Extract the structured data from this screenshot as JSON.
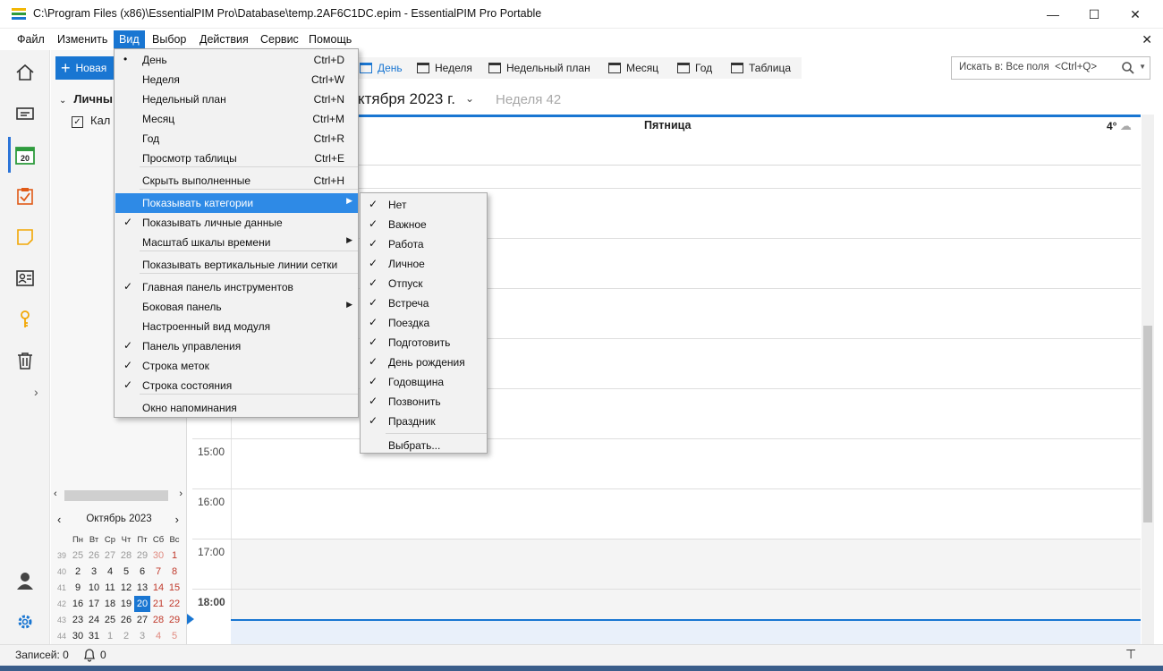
{
  "window": {
    "title": "C:\\Program Files (x86)\\EssentialPIM Pro\\Database\\temp.2AF6C1DC.epim - EssentialPIM Pro Portable",
    "minimize": "—",
    "maximize": "☐",
    "close": "✕"
  },
  "menubar": {
    "items": [
      "Файл",
      "Изменить",
      "Вид",
      "Выбор",
      "Действия",
      "Сервис",
      "Помощь"
    ],
    "active": "Вид",
    "close": "✕"
  },
  "sidebar": {
    "new_button": "Новая",
    "group": "Личны",
    "calendar_item": "Кал",
    "rail_icons": [
      "home-icon",
      "inbox-icon",
      "calendar-icon",
      "tasks-icon",
      "notes-icon",
      "contacts-icon",
      "passwords-icon",
      "trash-icon"
    ],
    "calendar_day": "20",
    "expand": "›"
  },
  "toolbar": {
    "views": [
      {
        "label": "День",
        "selected": true
      },
      {
        "label": "Неделя",
        "selected": false
      },
      {
        "label": "Недельный план",
        "selected": false
      },
      {
        "label": "Месяц",
        "selected": false
      },
      {
        "label": "Год",
        "selected": false
      },
      {
        "label": "Таблица",
        "selected": false
      }
    ],
    "search_placeholder": "Искать в: Все поля  <Ctrl+Q>"
  },
  "header": {
    "date_title": "ктября 2023 г.",
    "week": "Неделя 42",
    "day_name": "Пятница",
    "temperature": "4°"
  },
  "day_view": {
    "hours": [
      "15:00",
      "16:00",
      "17:00",
      "18:00"
    ],
    "grey_hours_from": "17:00"
  },
  "mini_calendar": {
    "title": "Октябрь  2023",
    "prev": "‹",
    "next": "›",
    "weekdays": [
      "Пн",
      "Вт",
      "Ср",
      "Чт",
      "Пт",
      "Сб",
      "Вс"
    ],
    "weeks": [
      {
        "no": "39",
        "days": [
          "25",
          "26",
          "27",
          "28",
          "29",
          "30",
          "1"
        ]
      },
      {
        "no": "40",
        "days": [
          "2",
          "3",
          "4",
          "5",
          "6",
          "7",
          "8"
        ]
      },
      {
        "no": "41",
        "days": [
          "9",
          "10",
          "11",
          "12",
          "13",
          "14",
          "15"
        ]
      },
      {
        "no": "42",
        "days": [
          "16",
          "17",
          "18",
          "19",
          "20",
          "21",
          "22"
        ]
      },
      {
        "no": "43",
        "days": [
          "23",
          "24",
          "25",
          "26",
          "27",
          "28",
          "29"
        ]
      },
      {
        "no": "44",
        "days": [
          "30",
          "31",
          "1",
          "2",
          "3",
          "4",
          "5"
        ]
      }
    ],
    "today": "20"
  },
  "view_menu": {
    "items": [
      {
        "label": "День",
        "shortcut": "Ctrl+D",
        "mark": "•"
      },
      {
        "label": "Неделя",
        "shortcut": "Ctrl+W",
        "mark": ""
      },
      {
        "label": "Недельный план",
        "shortcut": "Ctrl+N",
        "mark": ""
      },
      {
        "label": "Месяц",
        "shortcut": "Ctrl+M",
        "mark": ""
      },
      {
        "label": "Год",
        "shortcut": "Ctrl+R",
        "mark": ""
      },
      {
        "label": "Просмотр таблицы",
        "shortcut": "Ctrl+E",
        "mark": ""
      },
      {
        "label": "Скрыть выполненные",
        "shortcut": "Ctrl+H",
        "mark": ""
      },
      {
        "label": "Показывать категории",
        "shortcut": "",
        "mark": "",
        "submenu": true
      },
      {
        "label": "Показывать личные данные",
        "shortcut": "",
        "mark": "✓"
      },
      {
        "label": "Масштаб шкалы времени",
        "shortcut": "",
        "mark": "",
        "submenu": true
      },
      {
        "label": "Показывать вертикальные линии сетки",
        "shortcut": "",
        "mark": ""
      },
      {
        "label": "Главная панель инструментов",
        "shortcut": "",
        "mark": "✓"
      },
      {
        "label": "Боковая панель",
        "shortcut": "",
        "mark": "",
        "submenu": true
      },
      {
        "label": "Настроенный вид модуля",
        "shortcut": "",
        "mark": ""
      },
      {
        "label": "Панель управления",
        "shortcut": "",
        "mark": "✓"
      },
      {
        "label": "Строка меток",
        "shortcut": "",
        "mark": "✓"
      },
      {
        "label": "Строка состояния",
        "shortcut": "",
        "mark": "✓"
      },
      {
        "label": "Окно напоминания",
        "shortcut": "",
        "mark": ""
      }
    ],
    "highlighted": "Показывать категории"
  },
  "categories_menu": {
    "items": [
      {
        "label": "Нет",
        "mark": "✓"
      },
      {
        "label": "Важное",
        "mark": "✓"
      },
      {
        "label": "Работа",
        "mark": "✓"
      },
      {
        "label": "Личное",
        "mark": "✓"
      },
      {
        "label": "Отпуск",
        "mark": "✓"
      },
      {
        "label": "Встреча",
        "mark": "✓"
      },
      {
        "label": "Поездка",
        "mark": "✓"
      },
      {
        "label": "Подготовить",
        "mark": "✓"
      },
      {
        "label": "День рождения",
        "mark": "✓"
      },
      {
        "label": "Годовщина",
        "mark": "✓"
      },
      {
        "label": "Позвонить",
        "mark": "✓"
      },
      {
        "label": "Праздник",
        "mark": "✓"
      },
      {
        "label": "Выбрать...",
        "mark": ""
      }
    ]
  },
  "statusbar": {
    "records": "Записей: 0",
    "reminders": "0"
  },
  "colors": {
    "accent": "#1976d2",
    "menu_highlight": "#2e8ae6",
    "weekend": "#c0392b"
  }
}
